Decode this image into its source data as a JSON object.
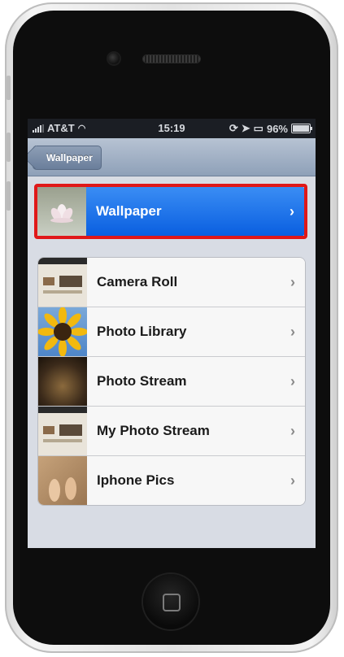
{
  "status": {
    "carrier": "AT&T",
    "time": "15:19",
    "battery": "96%",
    "battery_level": 0.96
  },
  "nav": {
    "back_label": "Wallpaper"
  },
  "selected": {
    "label": "Wallpaper",
    "highlight_color": "#e01818"
  },
  "albums": [
    {
      "label": "Camera Roll"
    },
    {
      "label": "Photo Library"
    },
    {
      "label": "Photo Stream"
    },
    {
      "label": "My Photo Stream"
    },
    {
      "label": "Iphone Pics"
    }
  ],
  "icons": {
    "chevron": "chevron-right-icon"
  },
  "colors": {
    "selected_row": "#1a70ea",
    "navbar": "#9fb0c6"
  }
}
